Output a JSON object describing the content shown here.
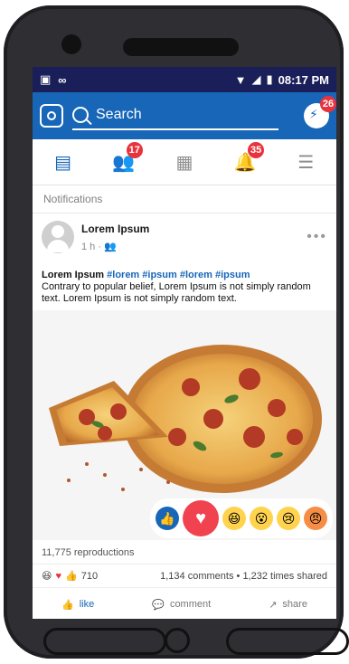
{
  "status": {
    "time": "08:17 PM"
  },
  "search": {
    "label": "Search"
  },
  "badges": {
    "messenger": "26",
    "friends": "17",
    "notifications": "35"
  },
  "section": {
    "title": "Notifications"
  },
  "post": {
    "author": "Lorem Ipsum",
    "time": "1 h",
    "captionName": "Lorem Ipsum",
    "tags": "#lorem #ipsum #lorem #ipsum",
    "body": "Contrary to popular belief, Lorem Ipsum is not simply random text. Lorem Ipsum is not simply random text."
  },
  "stats": {
    "reproductions": "11,775 reproductions",
    "reactions": "710",
    "comments": "1,134 comments",
    "shares": "1,232 times shared"
  },
  "actions": {
    "like": "like",
    "comment": "comment",
    "share": "share"
  },
  "colors": {
    "primary": "#1766b8",
    "statusbar": "#1a1f59",
    "badge": "#e8333d",
    "phone": "#2f2e33"
  }
}
